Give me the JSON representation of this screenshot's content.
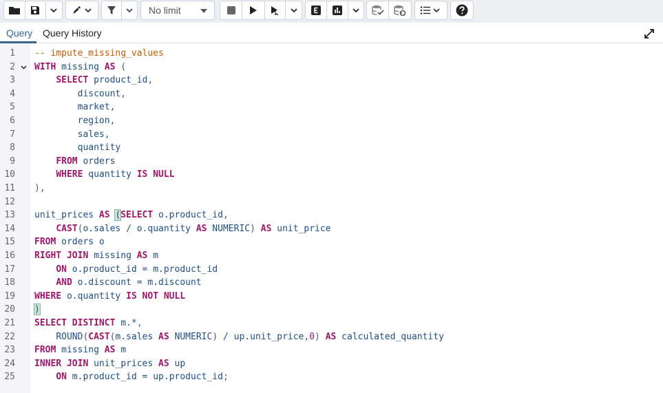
{
  "toolbar": {
    "limit_value": "No limit",
    "icons": [
      "folder-open-icon",
      "save-icon",
      "chevron-down-icon",
      "edit-pen-icon",
      "filter-icon",
      "stop-icon",
      "play-icon",
      "play-cursor-icon",
      "explain-icon",
      "explain-analyze-icon",
      "commit-icon",
      "rollback-icon",
      "macros-list-icon",
      "help-icon"
    ]
  },
  "tabs": {
    "query": "Query",
    "history": "Query History"
  },
  "editor": {
    "lines": [
      {
        "n": "1",
        "tokens": [
          [
            "c",
            "-- impute_missing_values"
          ]
        ]
      },
      {
        "n": "2",
        "fold": true,
        "tokens": [
          [
            "k",
            "WITH"
          ],
          [
            "t",
            " missing "
          ],
          [
            "k",
            "AS"
          ],
          [
            "p",
            " ("
          ]
        ]
      },
      {
        "n": "3",
        "tokens": [
          [
            "t",
            "    "
          ],
          [
            "k",
            "SELECT"
          ],
          [
            "t",
            " product_id"
          ],
          [
            "p",
            ","
          ]
        ]
      },
      {
        "n": "4",
        "tokens": [
          [
            "t",
            "        discount"
          ],
          [
            "p",
            ","
          ]
        ]
      },
      {
        "n": "5",
        "tokens": [
          [
            "t",
            "        market"
          ],
          [
            "p",
            ","
          ]
        ]
      },
      {
        "n": "6",
        "tokens": [
          [
            "t",
            "        region"
          ],
          [
            "p",
            ","
          ]
        ]
      },
      {
        "n": "7",
        "tokens": [
          [
            "t",
            "        sales"
          ],
          [
            "p",
            ","
          ]
        ]
      },
      {
        "n": "8",
        "tokens": [
          [
            "t",
            "        quantity"
          ]
        ]
      },
      {
        "n": "9",
        "tokens": [
          [
            "t",
            "    "
          ],
          [
            "k",
            "FROM"
          ],
          [
            "t",
            " orders"
          ]
        ]
      },
      {
        "n": "10",
        "tokens": [
          [
            "t",
            "    "
          ],
          [
            "k",
            "WHERE"
          ],
          [
            "t",
            " quantity "
          ],
          [
            "k",
            "IS NULL"
          ]
        ]
      },
      {
        "n": "11",
        "tokens": [
          [
            "p",
            "),"
          ]
        ]
      },
      {
        "n": "12",
        "tokens": []
      },
      {
        "n": "13",
        "tokens": [
          [
            "t",
            "unit_prices "
          ],
          [
            "k",
            "AS"
          ],
          [
            "t",
            " "
          ],
          [
            "h",
            "("
          ],
          [
            "k",
            "SELECT"
          ],
          [
            "t",
            " o.product_id"
          ],
          [
            "p",
            ","
          ]
        ]
      },
      {
        "n": "14",
        "tokens": [
          [
            "t",
            "    "
          ],
          [
            "k",
            "CAST"
          ],
          [
            "p",
            "("
          ],
          [
            "t",
            "o.sales / o.quantity "
          ],
          [
            "k",
            "AS"
          ],
          [
            "t",
            " NUMERIC"
          ],
          [
            "p",
            ")"
          ],
          [
            "t",
            " "
          ],
          [
            "k",
            "AS"
          ],
          [
            "t",
            " unit_price"
          ]
        ]
      },
      {
        "n": "15",
        "tokens": [
          [
            "k",
            "FROM"
          ],
          [
            "t",
            " orders o"
          ]
        ]
      },
      {
        "n": "16",
        "tokens": [
          [
            "k",
            "RIGHT JOIN"
          ],
          [
            "t",
            " missing "
          ],
          [
            "k",
            "AS"
          ],
          [
            "t",
            " m"
          ]
        ]
      },
      {
        "n": "17",
        "tokens": [
          [
            "t",
            "    "
          ],
          [
            "k",
            "ON"
          ],
          [
            "t",
            " o.product_id = m.product_id"
          ]
        ]
      },
      {
        "n": "18",
        "tokens": [
          [
            "t",
            "    "
          ],
          [
            "k",
            "AND"
          ],
          [
            "t",
            " o.discount = m.discount"
          ]
        ]
      },
      {
        "n": "19",
        "tokens": [
          [
            "k",
            "WHERE"
          ],
          [
            "t",
            " o.quantity "
          ],
          [
            "k",
            "IS NOT NULL"
          ]
        ]
      },
      {
        "n": "20",
        "tokens": [
          [
            "h",
            ")"
          ]
        ]
      },
      {
        "n": "21",
        "tokens": [
          [
            "k",
            "SELECT DISTINCT"
          ],
          [
            "t",
            " m.*"
          ],
          [
            "p",
            ","
          ]
        ]
      },
      {
        "n": "22",
        "tokens": [
          [
            "t",
            "    "
          ],
          [
            "t",
            "ROUND"
          ],
          [
            "p",
            "("
          ],
          [
            "k",
            "CAST"
          ],
          [
            "p",
            "("
          ],
          [
            "t",
            "m.sales "
          ],
          [
            "k",
            "AS"
          ],
          [
            "t",
            " NUMERIC"
          ],
          [
            "p",
            ")"
          ],
          [
            "t",
            " / up.unit_price"
          ],
          [
            "p",
            ","
          ],
          [
            "n",
            "0"
          ],
          [
            "p",
            ")"
          ],
          [
            "t",
            " "
          ],
          [
            "k",
            "AS"
          ],
          [
            "t",
            " calculated_quantity"
          ]
        ]
      },
      {
        "n": "23",
        "tokens": [
          [
            "k",
            "FROM"
          ],
          [
            "t",
            " missing "
          ],
          [
            "k",
            "AS"
          ],
          [
            "t",
            " m"
          ]
        ]
      },
      {
        "n": "24",
        "tokens": [
          [
            "k",
            "INNER JOIN"
          ],
          [
            "t",
            " unit_prices "
          ],
          [
            "k",
            "AS"
          ],
          [
            "t",
            " up"
          ]
        ]
      },
      {
        "n": "25",
        "tokens": [
          [
            "t",
            "    "
          ],
          [
            "k",
            "ON"
          ],
          [
            "t",
            " m.product_id = up.product_id"
          ],
          [
            "p",
            ";"
          ]
        ]
      }
    ]
  }
}
